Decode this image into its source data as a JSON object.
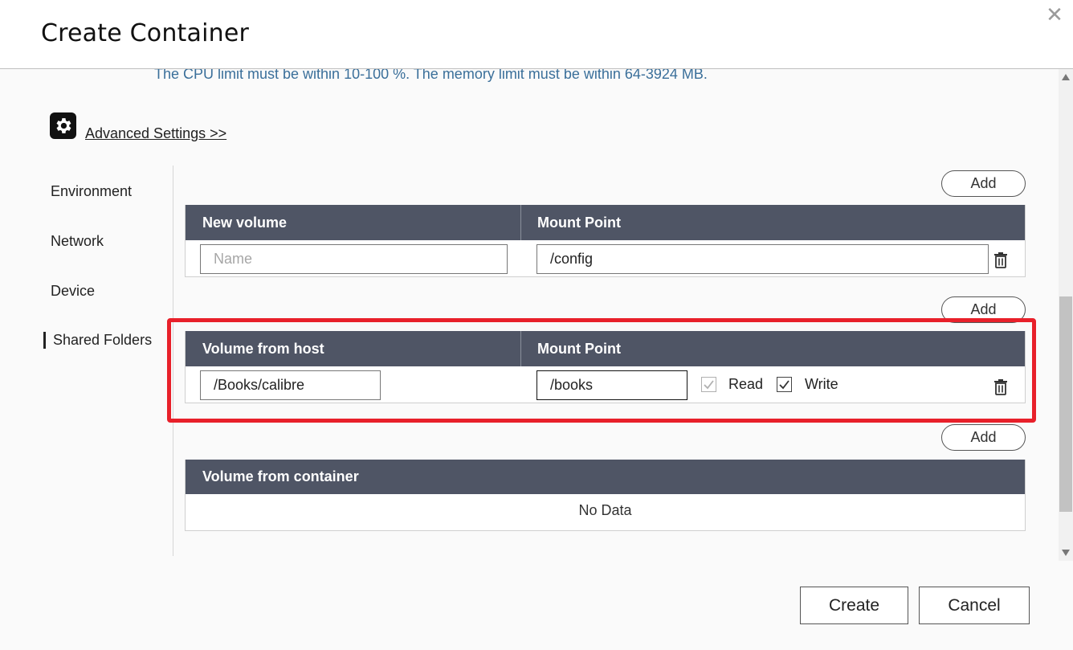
{
  "dialog": {
    "title": "Create Container",
    "close_icon": "close-icon"
  },
  "limits_note": "The CPU limit must be within 10-100 %. The memory limit must be within 64-3924 MB.",
  "advanced": {
    "icon": "gear-icon",
    "label": "Advanced Settings >>"
  },
  "sidebar": {
    "items": [
      {
        "label": "Environment",
        "active": false
      },
      {
        "label": "Network",
        "active": false
      },
      {
        "label": "Device",
        "active": false
      },
      {
        "label": "Shared Folders",
        "active": true
      }
    ]
  },
  "new_volume": {
    "add_label": "Add",
    "headers": [
      "New volume",
      "Mount Point"
    ],
    "row": {
      "name_placeholder": "Name",
      "name_value": "",
      "mount_point": "/config"
    }
  },
  "host_volume": {
    "add_label": "Add",
    "headers": [
      "Volume from host",
      "Mount Point"
    ],
    "row": {
      "host_path": "/Books/calibre",
      "mount_point": "/books",
      "read_label": "Read",
      "read_checked": true,
      "read_disabled": true,
      "write_label": "Write",
      "write_checked": true
    }
  },
  "container_volume": {
    "add_label": "Add",
    "headers": [
      "Volume from container"
    ],
    "empty_text": "No Data"
  },
  "footer": {
    "create_label": "Create",
    "cancel_label": "Cancel"
  },
  "colors": {
    "header_bg": "#4f5565",
    "highlight": "#e8202a",
    "note_text": "#3a6f9a"
  }
}
